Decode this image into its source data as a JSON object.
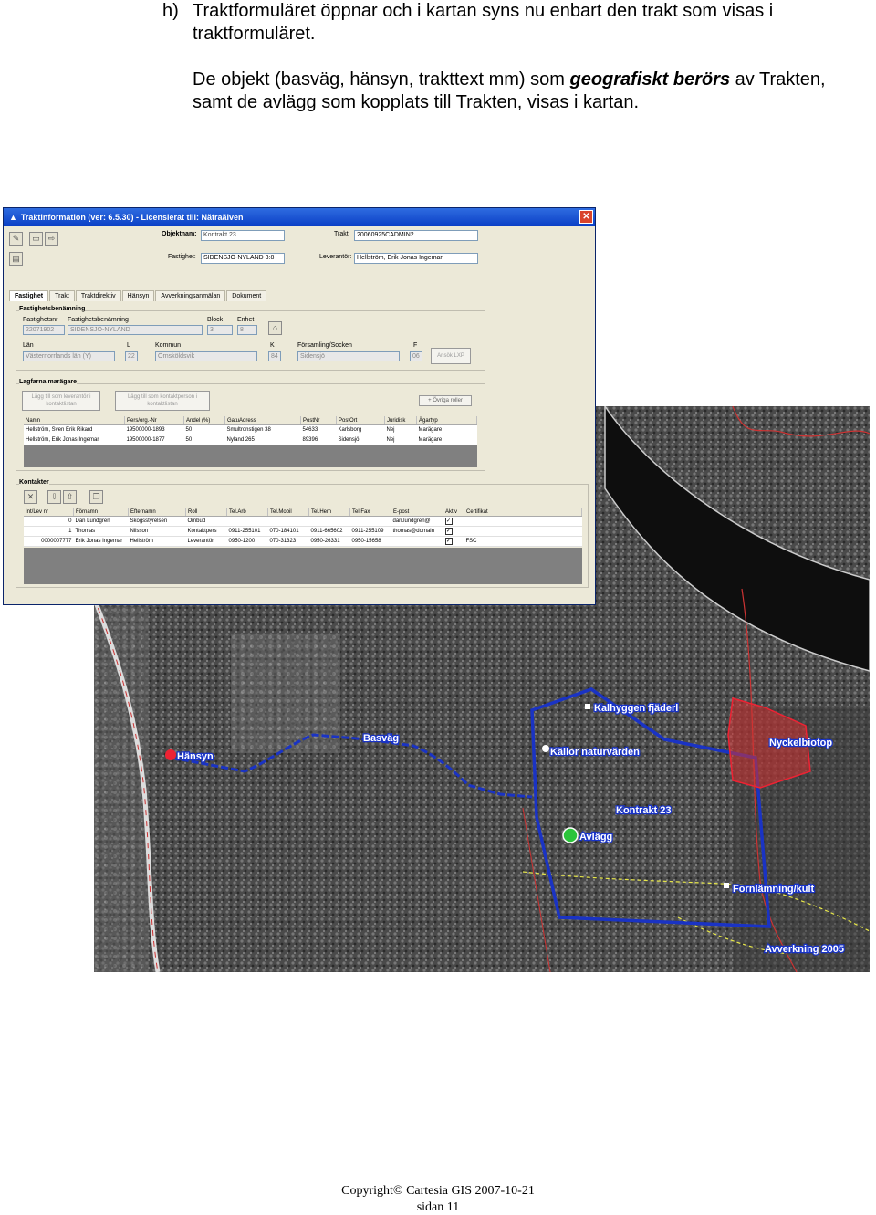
{
  "doc": {
    "item_marker": "h)",
    "para1": "Traktformuläret öppnar och i kartan syns nu enbart den trakt som visas i traktformuläret.",
    "para2_a": "De objekt (basväg, hänsyn, trakttext mm) som ",
    "para2_b": "geografiskt berörs",
    "para2_c": " av Trakten, samt de avlägg som kopplats till Trakten, visas i kartan.",
    "footer_line1": "Copyright© Cartesia GIS   2007-10-21",
    "footer_line2": "sidan 11"
  },
  "window": {
    "title": "Traktinformation (ver: 6.5.30) - Licensierat till: Nätraälven",
    "close": "✕",
    "objektnamn_label": "Objektnam:",
    "objektnamn_value": "Kontrakt 23",
    "trakt_label": "Trakt:",
    "trakt_value": "20060925CADMIN2",
    "fastighet_label": "Fastighet:",
    "fastighet_value": "SIDENSJÖ-NYLAND 3:8",
    "leverantor_label": "Leverantör:",
    "leverantor_value": "Hellström, Erik Jonas Ingemar",
    "tabs": [
      "Fastighet",
      "Trakt",
      "Traktdirektiv",
      "Hänsyn",
      "Avverkningsanmälan",
      "Dokument"
    ],
    "fb_title": "Fastighetsbenämning",
    "fb_nr_label": "Fastighetsnr",
    "fb_nr_value": "22071902",
    "fb_ben_label": "Fastighetsbenämning",
    "fb_ben_value": "SIDENSJÖ-NYLAND",
    "block_label": "Block",
    "block_value": "3",
    "enhet_label": "Enhet",
    "enhet_value": "8",
    "lan_label": "Län",
    "lan_value": "Västernorrlands län (Y)",
    "l_label": "L",
    "l_value": "22",
    "kommun_label": "Kommun",
    "kommun_value": "Örnsköldsvik",
    "k_label": "K",
    "k_value": "84",
    "forsamling_label": "Församling/Socken",
    "forsamling_value": "Sidensjö",
    "f_label": "F",
    "f_value": "06",
    "ansok_button": "Ansök LXP",
    "lm_title": "Lagfarna marägare",
    "lm_btn1": "Lägg till som leverantör i kontaktlistan",
    "lm_btn2": "Lägg till som kontaktperson i kontaktlistan",
    "lm_btn3": "+ Övriga roller",
    "lm_cols": [
      "Namn",
      "Pers/org.-Nr",
      "Andel (%)",
      "GatuAdress",
      "PostNr",
      "PostOrt",
      "Juridisk",
      "Ägartyp"
    ],
    "lm_rows": [
      [
        "Hellström, Sven Erik Rikard",
        "19500000-1893",
        "50",
        "Smultronstigen 38",
        "54633",
        "Karlsborg",
        "Nej",
        "Marägare"
      ],
      [
        "Hellström, Erik Jonas Ingemar",
        "19500000-1877",
        "50",
        "Nyland 265",
        "89396",
        "Sidensjö",
        "Nej",
        "Marägare"
      ]
    ],
    "kontakter_title": "Kontakter",
    "k_cols": [
      "Int/Lev nr",
      "Förnamn",
      "Efternamn",
      "Roll",
      "Tel.Arb",
      "Tel.Mobil",
      "Tel.Hem",
      "Tel.Fax",
      "E-post",
      "Aktiv",
      "Certifikat"
    ],
    "k_rows": [
      [
        "0",
        "Dan Lundgren",
        "Skogsstyrelsen",
        "Ombud",
        "",
        "",
        "",
        "",
        "dan.lundgren@",
        "✓",
        ""
      ],
      [
        "1",
        "Thomas",
        "Nilsson",
        "Kontaktpers",
        "0911-255101",
        "070-184101",
        "0911-665602",
        "0911-255109",
        "thomas@domain",
        "✓",
        ""
      ],
      [
        "0000007777",
        "Erik Jonas Ingemar",
        "Hellström",
        "Leverantör",
        "0950-1200",
        "070-31323",
        "0950-26331",
        "0950-15658",
        "",
        "✓",
        "FSC"
      ]
    ]
  },
  "map": {
    "labels": {
      "kalhygge": "Kalhyggen fjäderl",
      "basvag": "Basväg",
      "nyckelbiotop": "Nyckelbiotop",
      "kallor": "Källor naturvärden",
      "kontrakt": "Kontrakt 23",
      "avlagg": "Avlägg",
      "hansyn": "Hänsyn",
      "fornlamning": "Fornlämning/kult",
      "avverkning": "Avverkning 2005"
    }
  }
}
